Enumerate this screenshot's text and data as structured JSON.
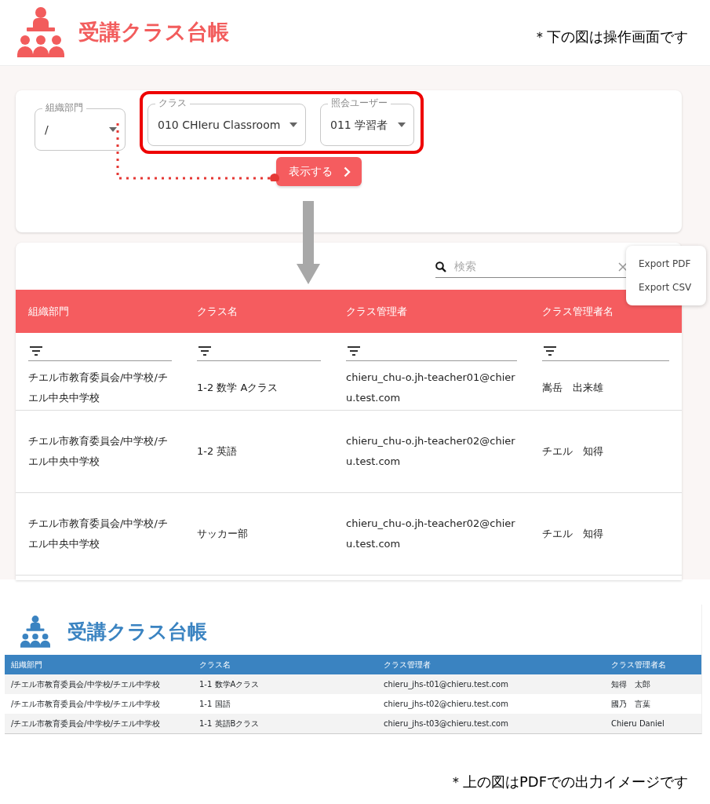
{
  "header": {
    "title": "受講クラス台帳",
    "note": "＊下の図は操作画面です"
  },
  "filters": [
    {
      "label": "組織部門",
      "value": "/",
      "highlighted": false
    },
    {
      "label": "クラス",
      "value": "010 CHIeru Classroom",
      "highlighted": true
    },
    {
      "label": "照会ユーザー",
      "value": "011 学習者",
      "highlighted": true
    }
  ],
  "show_button": "表示する",
  "search": {
    "placeholder": "検索"
  },
  "export_menu": [
    "Export PDF",
    "Export CSV"
  ],
  "table": {
    "columns": [
      "組織部門",
      "クラス名",
      "クラス管理者",
      "クラス管理者名"
    ],
    "rows": [
      [
        "チエル市教育委員会/中学校/チエル中央中学校",
        "1-2 数学 Aクラス",
        "chieru_chu-o.jh-teacher01@chieru.test.com",
        "嵩岳　出来雄"
      ],
      [
        "チエル市教育委員会/中学校/チエル中央中学校",
        "1-2 英語",
        "chieru_chu-o.jh-teacher02@chieru.test.com",
        "チエル　知得"
      ],
      [
        "チエル市教育委員会/中学校/チエル中央中学校",
        "サッカー部",
        "chieru_chu-o.jh-teacher02@chieru.test.com",
        "チエル　知得"
      ]
    ]
  },
  "pdf_preview": {
    "title": "受講クラス台帳",
    "columns": [
      "組織部門",
      "クラス名",
      "クラス管理者",
      "クラス管理者名"
    ],
    "rows": [
      [
        "/チエル市教育委員会/中学校/チエル中学校",
        "1-1 数学Aクラス",
        "chieru_jhs-t01@chieru.test.com",
        "知得　太郎"
      ],
      [
        "/チエル市教育委員会/中学校/チエル中学校",
        "1-1 国語",
        "chieru_jhs-t02@chieru.test.com",
        "國乃　言葉"
      ],
      [
        "/チエル市教育委員会/中学校/チエル中学校",
        "1-1 英語Bクラス",
        "chieru_jhs-t03@chieru.test.com",
        "Chieru Daniel"
      ]
    ]
  },
  "footer_note": "＊上の図はPDFでの出力イメージです"
}
